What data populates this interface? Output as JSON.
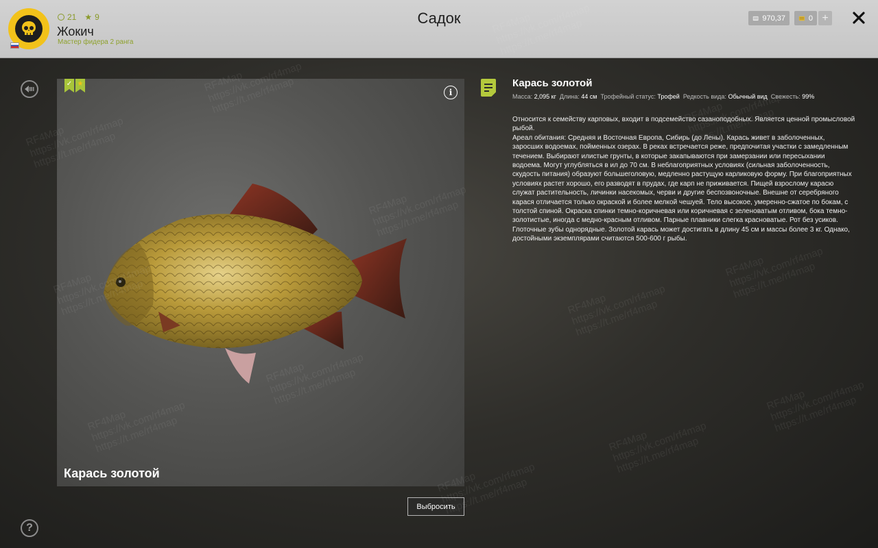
{
  "header": {
    "title": "Садок",
    "player": {
      "name": "Жокич",
      "rank": "Мастер фидера 2 ранга",
      "level": "21",
      "stars": "9"
    },
    "currency": {
      "silver": "970,37",
      "gold": "0"
    },
    "plus_label": "+"
  },
  "fish": {
    "caption": "Карась золотой",
    "title": "Карась золотой",
    "meta": {
      "mass_label": "Масса:",
      "mass_value": "2,095 кг",
      "length_label": "Длина:",
      "length_value": "44 см",
      "trophy_label": "Трофейный статус:",
      "trophy_value": "Трофей",
      "rarity_label": "Редкость вида:",
      "rarity_value": "Обычный вид",
      "fresh_label": "Свежесть:",
      "fresh_value": "99%"
    },
    "description": [
      "Относится к семейству карповых, входит в подсемейство сазаноподобных. Является ценной промысловой рыбой.",
      "Ареал обитания: Средняя и Восточная Европа, Сибирь (до Лены). Карась живет в заболоченных, заросших водоемах, пойменных озерах. В реках встречается реже, предпочитая участки с замедленным течением. Выбирают илистые грунты, в которые закапываются при замерзании или пересыхании водоема. Могут углубляться в ил до 70 см. В неблагоприятных условиях (сильная заболоченность, скудость питания) образуют большеголовую, медленно растущую карликовую форму. При благоприятных условиях растет хорошо, его разводят в прудах, где карп не приживается. Пищей взрослому карасю служат растительность, личинки насекомых, черви и другие беспозвоночные. Внешне от серебряного карася отличается только окраской и более мелкой чешуей. Тело высокое, умеренно-сжатое по бокам, с толстой спиной. Окраска спинки темно-коричневая или коричневая с зеленоватым отливом, бока темно-золотистые, иногда с медно-красным отливом. Парные плавники слегка красноватые. Рот без усиков. Глоточные зубы однорядные. Золотой карась может достигать в длину 45 см и массы более 3 кг. Однако, достойными экземплярами считаются 500-600 г рыбы."
    ],
    "badges": {
      "check": "✓",
      "star": "★"
    }
  },
  "actions": {
    "discard_label": "Выбросить",
    "help_label": "?"
  },
  "watermark": {
    "name": "RF4Map",
    "vk": "https://vk.com/rf4map",
    "tg": "https://t.me/rf4map"
  },
  "colors": {
    "accent": "#a8c43a",
    "avatar": "#f2c21a",
    "header": "#c8c8c8"
  },
  "icons": [
    "skull-icon",
    "back-icon",
    "help-icon",
    "info-icon",
    "close-icon",
    "silver-icon",
    "gold-icon",
    "document-icon"
  ]
}
